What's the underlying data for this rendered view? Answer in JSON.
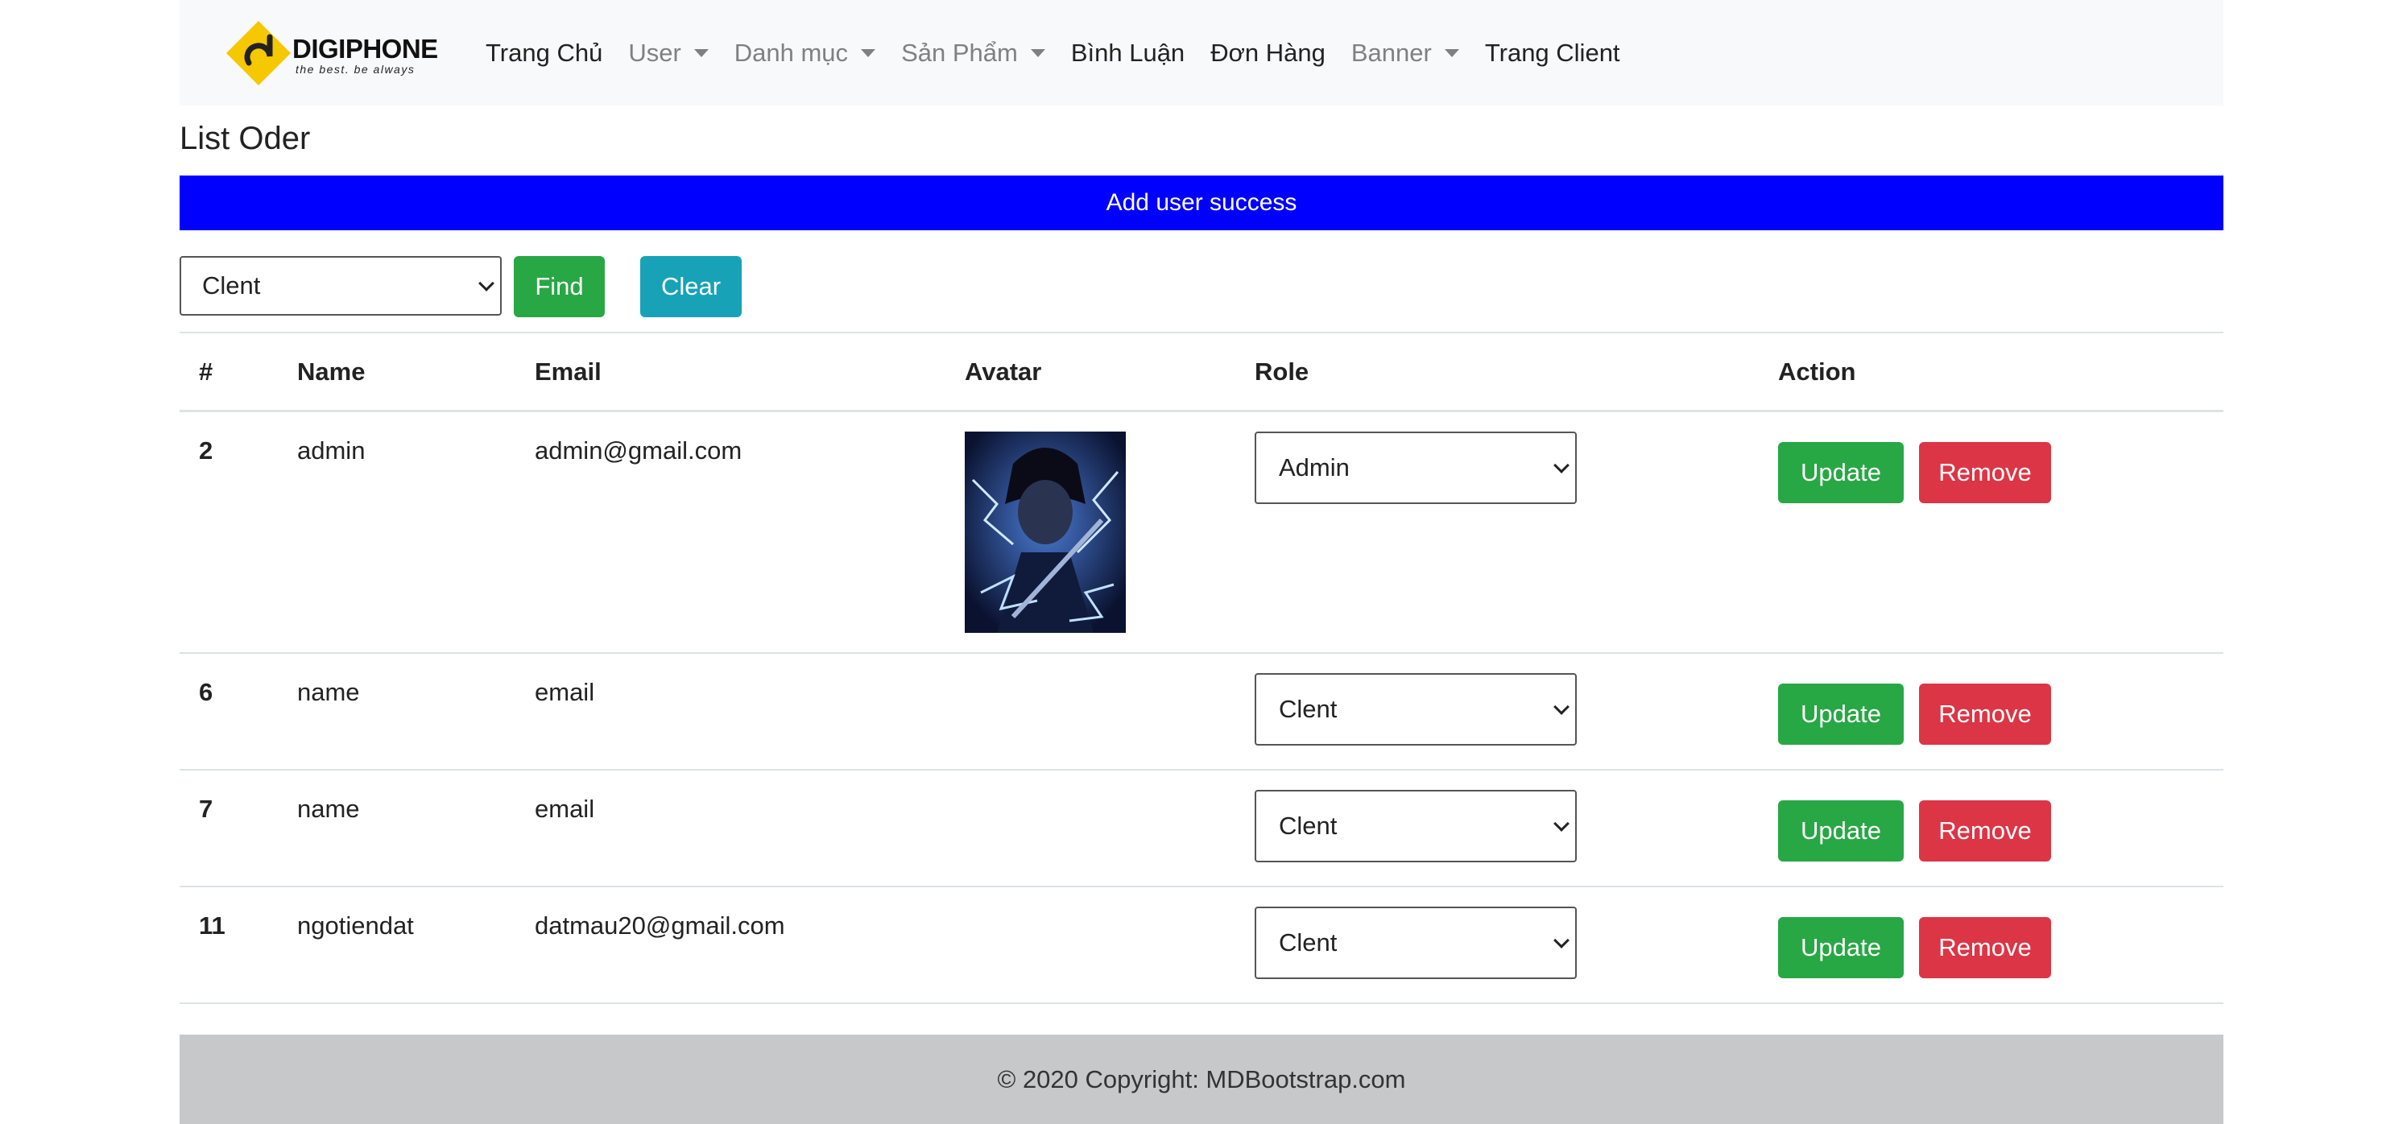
{
  "brand": {
    "name": "DIGIPHONE",
    "tagline": "the best. be always",
    "accent_color": "#f5c800"
  },
  "nav": {
    "items": [
      {
        "label": "Trang Chủ",
        "dropdown": false,
        "muted": false
      },
      {
        "label": "User",
        "dropdown": true,
        "muted": true
      },
      {
        "label": "Danh mục",
        "dropdown": true,
        "muted": true
      },
      {
        "label": "Sản Phẩm",
        "dropdown": true,
        "muted": true
      },
      {
        "label": "Bình Luận",
        "dropdown": false,
        "muted": false
      },
      {
        "label": "Đơn Hàng",
        "dropdown": false,
        "muted": false
      },
      {
        "label": "Banner",
        "dropdown": true,
        "muted": true
      },
      {
        "label": "Trang Client",
        "dropdown": false,
        "muted": false
      }
    ]
  },
  "page": {
    "title": "List Oder",
    "alert": "Add user success",
    "alert_color": "#0000ff"
  },
  "filter": {
    "selected": "Clent",
    "find_label": "Find",
    "clear_label": "Clear"
  },
  "table": {
    "headers": [
      "#",
      "Name",
      "Email",
      "Avatar",
      "Role",
      "Action"
    ],
    "rows": [
      {
        "id": "2",
        "name": "admin",
        "email": "admin@gmail.com",
        "has_avatar": true,
        "role": "Admin",
        "update": "Update",
        "remove": "Remove"
      },
      {
        "id": "6",
        "name": "name",
        "email": "email",
        "has_avatar": false,
        "role": "Clent",
        "update": "Update",
        "remove": "Remove"
      },
      {
        "id": "7",
        "name": "name",
        "email": "email",
        "has_avatar": false,
        "role": "Clent",
        "update": "Update",
        "remove": "Remove"
      },
      {
        "id": "11",
        "name": "ngotiendat",
        "email": "datmau20@gmail.com",
        "has_avatar": false,
        "role": "Clent",
        "update": "Update",
        "remove": "Remove"
      }
    ]
  },
  "footer": {
    "text": "© 2020 Copyright: MDBootstrap.com"
  }
}
